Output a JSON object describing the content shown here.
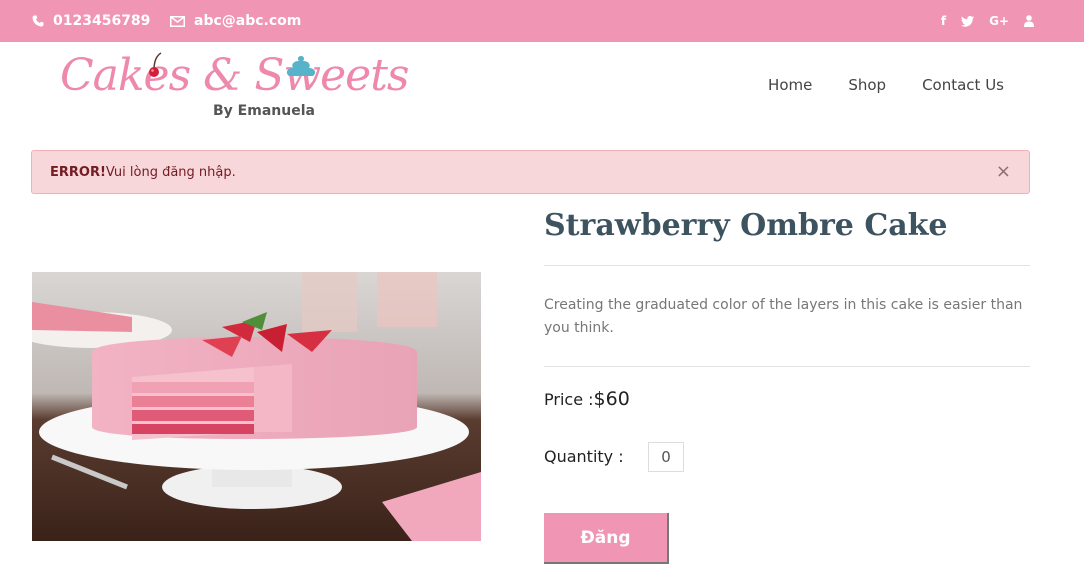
{
  "topbar": {
    "phone": "0123456789",
    "email": "abc@abc.com",
    "socials": [
      {
        "icon": "facebook-icon",
        "glyph": "f"
      },
      {
        "icon": "twitter-icon",
        "glyph": "t"
      },
      {
        "icon": "google-plus-icon",
        "glyph": "G+"
      },
      {
        "icon": "user-icon",
        "glyph": ""
      }
    ]
  },
  "logo": {
    "title": "Cakes & Sweets",
    "subtitle": "By Emanuela"
  },
  "nav": {
    "items": [
      "Home",
      "Shop",
      "Contact Us"
    ]
  },
  "alert": {
    "label": "ERROR!",
    "message": "Vui lòng đăng nhập.",
    "close": "×"
  },
  "product": {
    "title": "Strawberry Ombre Cake",
    "description": "Creating the graduated color of the layers in this cake is easier than you think.",
    "price_label": "Price :",
    "price_value": "$60",
    "quantity_label": "Quantity :",
    "quantity_value": "0",
    "submit_label": "Đăng"
  },
  "colors": {
    "brand_pink": "#f195b4",
    "title_slate": "#3d5360",
    "alert_bg": "#f8d7da"
  }
}
